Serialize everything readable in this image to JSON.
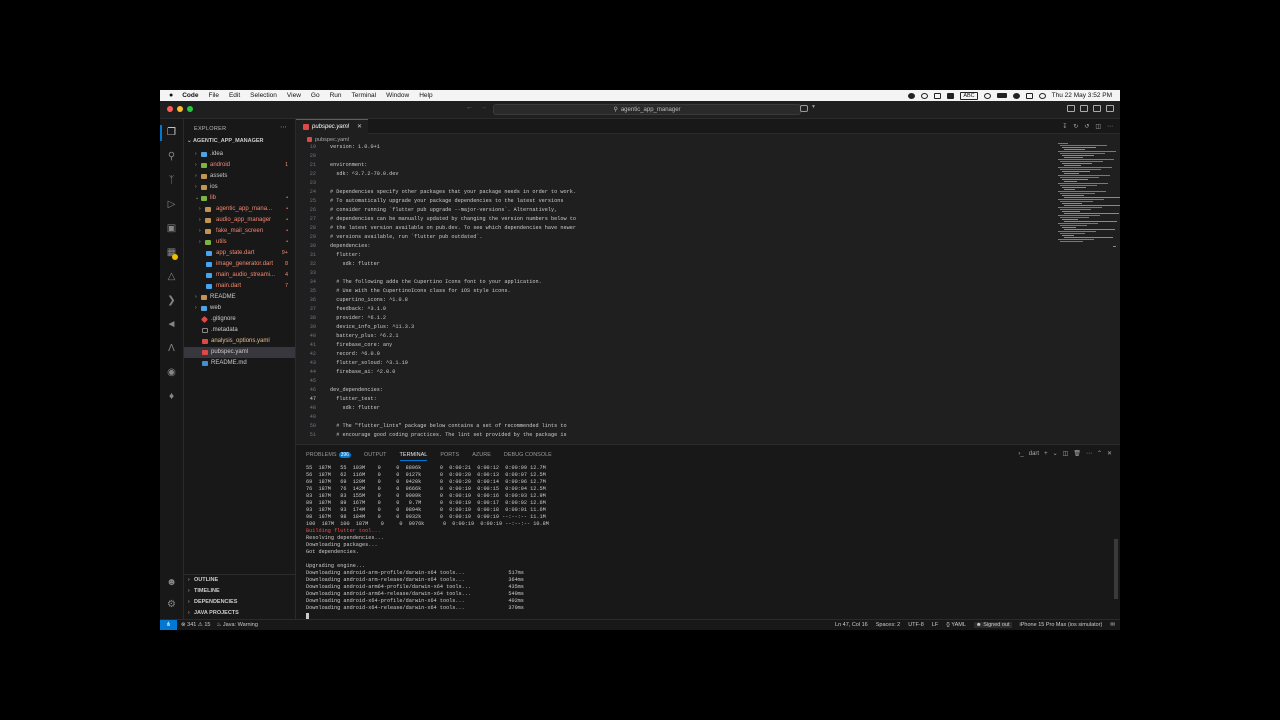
{
  "menubar": {
    "app": "Code",
    "items": [
      "File",
      "Edit",
      "Selection",
      "View",
      "Go",
      "Run",
      "Terminal",
      "Window",
      "Help"
    ],
    "input_source": "ABC",
    "datetime": "Thu 22 May  3:52 PM"
  },
  "titlebar": {
    "search_text": "agentic_app_manager"
  },
  "sidebar": {
    "header": "EXPLORER",
    "root": "AGENTIC_APP_MANAGER",
    "tree": [
      {
        "label": ".idea",
        "deco": "",
        "color": "default"
      },
      {
        "label": "android",
        "deco": "1",
        "color": "red"
      },
      {
        "label": "assets",
        "deco": "",
        "color": "default"
      },
      {
        "label": "ios",
        "deco": "",
        "color": "default"
      },
      {
        "label": "lib",
        "deco": "•",
        "color": "red"
      },
      {
        "label": "agentic_app_mana...",
        "deco": "•",
        "color": "red"
      },
      {
        "label": "audio_app_manager",
        "deco": "•",
        "color": "red"
      },
      {
        "label": "fake_mail_screen",
        "deco": "•",
        "color": "red"
      },
      {
        "label": "utils",
        "deco": "•",
        "color": "red"
      },
      {
        "label": "app_state.dart",
        "deco": "9+",
        "color": "red"
      },
      {
        "label": "image_generator.dart",
        "deco": "8",
        "color": "red"
      },
      {
        "label": "main_audio_streami...",
        "deco": "4",
        "color": "red"
      },
      {
        "label": "main.dart",
        "deco": "7",
        "color": "red"
      },
      {
        "label": "README",
        "deco": "",
        "color": "default"
      },
      {
        "label": "web",
        "deco": "",
        "color": "default"
      },
      {
        "label": ".gitignore",
        "deco": "",
        "color": "default"
      },
      {
        "label": ".metadata",
        "deco": "",
        "color": "default"
      },
      {
        "label": "analysis_options.yaml",
        "deco": "",
        "color": "yellow"
      },
      {
        "label": "pubspec.yaml",
        "deco": "",
        "color": "default"
      },
      {
        "label": "README.md",
        "deco": "",
        "color": "default"
      }
    ],
    "bottom_sections": [
      "OUTLINE",
      "TIMELINE",
      "DEPENDENCIES",
      "JAVA PROJECTS"
    ]
  },
  "editor": {
    "tab_label": "pubspec.yaml",
    "breadcrumb": "pubspec.yaml",
    "lines": [
      {
        "n": "19",
        "t": "version: 1.0.0+1"
      },
      {
        "n": "20",
        "t": ""
      },
      {
        "n": "21",
        "t": "environment:"
      },
      {
        "n": "22",
        "t": "  sdk: ^3.7.2-70.0.dev"
      },
      {
        "n": "23",
        "t": ""
      },
      {
        "n": "24",
        "t": "# Dependencies specify other packages that your package needs in order to work."
      },
      {
        "n": "25",
        "t": "# To automatically upgrade your package dependencies to the latest versions"
      },
      {
        "n": "26",
        "t": "# consider running `flutter pub upgrade --major-versions`. Alternatively,"
      },
      {
        "n": "27",
        "t": "# dependencies can be manually updated by changing the version numbers below to"
      },
      {
        "n": "28",
        "t": "# the latest version available on pub.dev. To see which dependencies have newer"
      },
      {
        "n": "29",
        "t": "# versions available, run `flutter pub outdated`."
      },
      {
        "n": "30",
        "t": "dependencies:"
      },
      {
        "n": "31",
        "t": "  flutter:"
      },
      {
        "n": "32",
        "t": "    sdk: flutter"
      },
      {
        "n": "33",
        "t": ""
      },
      {
        "n": "34",
        "t": "  # The following adds the Cupertino Icons font to your application."
      },
      {
        "n": "35",
        "t": "  # Use with the CupertinoIcons class for iOS style icons."
      },
      {
        "n": "36",
        "t": "  cupertino_icons: ^1.0.8"
      },
      {
        "n": "37",
        "t": "  feedback: ^3.1.0"
      },
      {
        "n": "38",
        "t": "  provider: ^6.1.2"
      },
      {
        "n": "39",
        "t": "  device_info_plus: ^11.3.3"
      },
      {
        "n": "40",
        "t": "  battery_plus: ^6.2.1"
      },
      {
        "n": "41",
        "t": "  firebase_core: any"
      },
      {
        "n": "42",
        "t": "  record: ^6.0.0"
      },
      {
        "n": "43",
        "t": "  flutter_soloud: ^3.1.10"
      },
      {
        "n": "44",
        "t": "  firebase_ai: ^2.0.0"
      },
      {
        "n": "45",
        "t": ""
      },
      {
        "n": "46",
        "t": "dev_dependencies:"
      },
      {
        "n": "47",
        "t": "  flutter_test:"
      },
      {
        "n": "48",
        "t": "    sdk: flutter"
      },
      {
        "n": "49",
        "t": ""
      },
      {
        "n": "50",
        "t": "  # The \"flutter_lints\" package below contains a set of recommended lints to"
      },
      {
        "n": "51",
        "t": "  # encourage good coding practices. The lint set provided by the package is"
      }
    ]
  },
  "panel": {
    "tabs": [
      "PROBLEMS",
      "OUTPUT",
      "TERMINAL",
      "PORTS",
      "AZURE",
      "DEBUG CONSOLE"
    ],
    "problems_count": "396",
    "active_tab": "TERMINAL",
    "terminal_name": "dart",
    "terminal_lines": [
      {
        "t": "55  187M   55  103M    0     0  8806k      0  0:00:21  0:00:12  0:00:09 12.7M",
        "err": false
      },
      {
        "t": "56  187M   62  116M    0     0  9127k      0  0:00:20  0:00:13  0:00:07 12.5M",
        "err": false
      },
      {
        "t": "69  187M   69  129M    0     0  9420k      0  0:00:20  0:00:14  0:00:06 12.7M",
        "err": false
      },
      {
        "t": "76  187M   76  142M    0     0  9666k      0  0:00:19  0:00:15  0:00:04 12.5M",
        "err": false
      },
      {
        "t": "83  187M   83  155M    0     0  9909k      0  0:00:19  0:00:16  0:00:03 12.9M",
        "err": false
      },
      {
        "t": "89  187M   89  167M    0     0   9.7M      0  0:00:19  0:00:17  0:00:02 12.6M",
        "err": false
      },
      {
        "t": "93  187M   93  174M    0     0  9894k      0  0:00:19  0:00:18  0:00:01 11.6M",
        "err": false
      },
      {
        "t": "98  187M   98  184M    0     0  9932k      0  0:00:19  0:00:19 --:--:-- 11.1M",
        "err": false
      },
      {
        "t": "100  187M  100  187M    0     0  9976k      0  0:00:19  0:00:19 --:--:-- 10.8M",
        "err": false
      },
      {
        "t": "Building flutter tool...",
        "err": true
      },
      {
        "t": "Resolving dependencies...",
        "err": false
      },
      {
        "t": "Downloading packages...",
        "err": false
      },
      {
        "t": "Got dependencies.",
        "err": false
      },
      {
        "t": "",
        "err": false
      },
      {
        "t": "Upgrading engine...",
        "err": false
      },
      {
        "t": "Downloading android-arm-profile/darwin-x64 tools...              517ms",
        "err": false
      },
      {
        "t": "Downloading android-arm-release/darwin-x64 tools...              364ms",
        "err": false
      },
      {
        "t": "Downloading android-arm64-profile/darwin-x64 tools...            435ms",
        "err": false
      },
      {
        "t": "Downloading android-arm64-release/darwin-x64 tools...            540ms",
        "err": false
      },
      {
        "t": "Downloading android-x64-profile/darwin-x64 tools...              402ms",
        "err": false
      },
      {
        "t": "Downloading android-x64-release/darwin-x64 tools...              370ms",
        "err": false
      }
    ]
  },
  "statusbar": {
    "errors": "341",
    "warnings": "15",
    "java_status": "Java: Warning",
    "position": "Ln 47, Col 16",
    "spaces": "Spaces: 2",
    "encoding": "UTF-8",
    "eol": "LF",
    "language": "YAML",
    "account": "Signed out",
    "device": "iPhone 15 Pro Max (ios simulator)"
  },
  "colors": {
    "accent": "#0078d4",
    "error_text": "#f48771",
    "warning_text": "#e2c08d",
    "background": "#181818"
  }
}
